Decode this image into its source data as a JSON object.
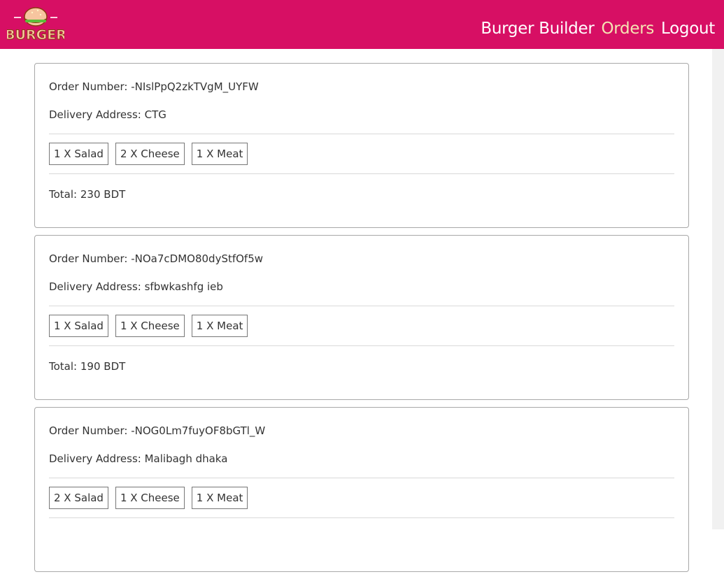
{
  "brand": {
    "logo_text": "BURGER",
    "colors": {
      "navbar": "#d70f64",
      "active_link": "#f5e3b3",
      "link": "#ffffff"
    }
  },
  "nav": {
    "items": [
      {
        "label": "Burger Builder",
        "active": false
      },
      {
        "label": "Orders",
        "active": true
      },
      {
        "label": "Logout",
        "active": false
      }
    ]
  },
  "orders": [
    {
      "number_label": "Order Number:",
      "number": "-NIslPpQ2zkTVgM_UYFW",
      "address_label": "Delivery Address:",
      "address": "CTG",
      "ingredients": [
        "1 X Salad",
        "2 X Cheese",
        "1 X Meat"
      ],
      "total_label": "Total:",
      "total": "230 BDT"
    },
    {
      "number_label": "Order Number:",
      "number": "-NOa7cDMO80dyStfOf5w",
      "address_label": "Delivery Address:",
      "address": "sfbwkashfg ieb",
      "ingredients": [
        "1 X Salad",
        "1 X Cheese",
        "1 X Meat"
      ],
      "total_label": "Total:",
      "total": "190 BDT"
    },
    {
      "number_label": "Order Number:",
      "number": "-NOG0Lm7fuyOF8bGTl_W",
      "address_label": "Delivery Address:",
      "address": "Malibagh dhaka",
      "ingredients": [
        "2 X Salad",
        "1 X Cheese",
        "1 X Meat"
      ],
      "total_label": "Total:",
      "total": ""
    }
  ]
}
